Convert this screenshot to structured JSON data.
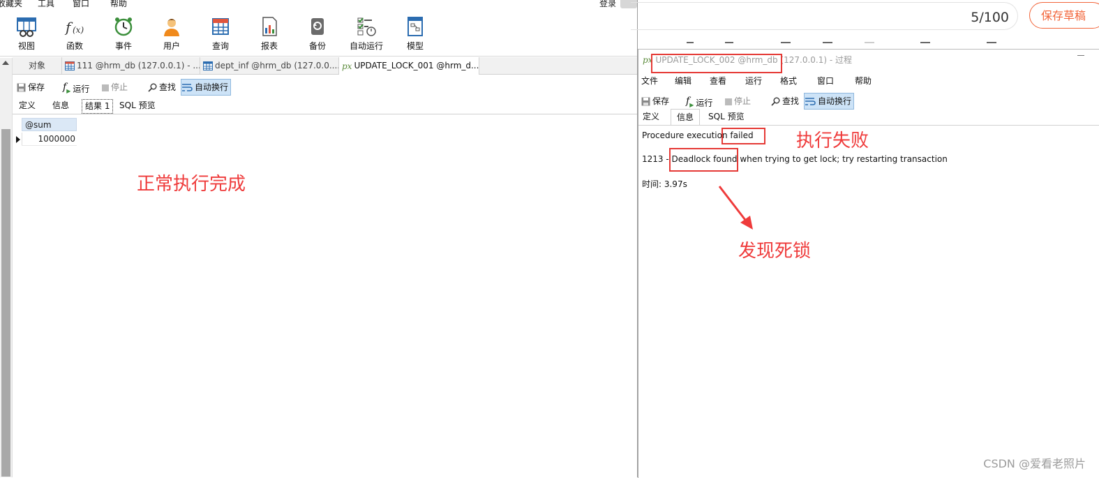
{
  "left_window": {
    "menu": [
      "收藏夹",
      "工具",
      "窗口",
      "帮助"
    ],
    "login_label": "登录",
    "toolbar": [
      {
        "label": "视图",
        "icon": "view-icon"
      },
      {
        "label": "函数",
        "icon": "function-icon"
      },
      {
        "label": "事件",
        "icon": "event-clock-icon"
      },
      {
        "label": "用户",
        "icon": "user-icon"
      },
      {
        "label": "查询",
        "icon": "query-icon"
      },
      {
        "label": "报表",
        "icon": "report-icon"
      },
      {
        "label": "备份",
        "icon": "backup-icon"
      },
      {
        "label": "自动运行",
        "icon": "auto-run-icon"
      },
      {
        "label": "模型",
        "icon": "model-icon"
      }
    ],
    "tabs": [
      {
        "label": "对象"
      },
      {
        "label": "111 @hrm_db (127.0.0.1) - ..."
      },
      {
        "label": "dept_inf @hrm_db (127.0.0...."
      },
      {
        "label": "UPDATE_LOCK_001 @hrm_d..."
      }
    ],
    "actions": {
      "save": "保存",
      "run": "运行",
      "stop": "停止",
      "find": "查找",
      "wrap": "自动换行"
    },
    "subtabs": [
      "定义",
      "信息",
      "结果 1",
      "SQL 预览"
    ],
    "result": {
      "column": "@sum",
      "value": "1000000"
    },
    "annotation": "正常执行完成"
  },
  "editor": {
    "word_count": "5/100",
    "save_draft": "保存草稿"
  },
  "right_window": {
    "title": "UPDATE_LOCK_002 @hrm_db (127.0.0.1) - 过程",
    "menu": [
      "文件",
      "编辑",
      "查看",
      "运行",
      "格式",
      "窗口",
      "帮助"
    ],
    "actions": {
      "save": "保存",
      "run": "运行",
      "stop": "停止",
      "find": "查找",
      "wrap": "自动换行"
    },
    "subtabs": [
      "定义",
      "信息",
      "SQL 预览"
    ],
    "messages": {
      "line1": "Procedure execution failed",
      "line2": "1213 - Deadlock found when trying to get lock; try restarting transaction",
      "line3": "时间: 3.97s"
    },
    "annotations": {
      "failed": "执行失败",
      "deadlock": "发现死锁"
    }
  },
  "watermark": "CSDN @爱看老照片",
  "colors": {
    "annotation_red": "#ef3b3b",
    "box_red": "#e53935",
    "save_draft_orange": "#f2653a",
    "wrap_active_bg": "#cde3f7"
  }
}
